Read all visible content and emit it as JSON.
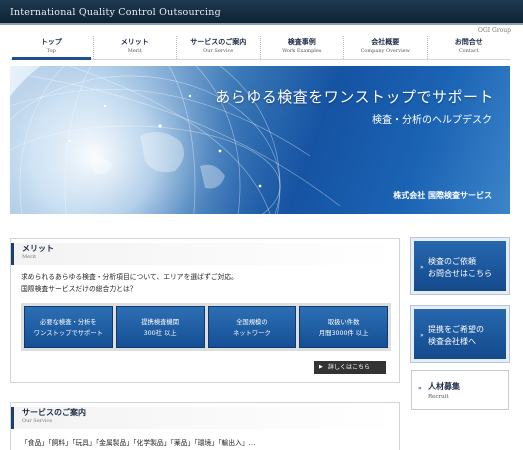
{
  "header": {
    "site_title": "International Quality Control Outsourcing",
    "group_label": "OGI Group"
  },
  "nav": [
    {
      "jp": "トップ",
      "en": "Top"
    },
    {
      "jp": "メリット",
      "en": "Merit"
    },
    {
      "jp": "サービスのご案内",
      "en": "Our Service"
    },
    {
      "jp": "検査事例",
      "en": "Work Examples"
    },
    {
      "jp": "会社概要",
      "en": "Company Overview"
    },
    {
      "jp": "お問合せ",
      "en": "Contact"
    }
  ],
  "hero": {
    "headline": "あらゆる検査をワンストップでサポート",
    "subheadline": "検査・分析のヘルプデスク",
    "company": "株式会社 国際検査サービス"
  },
  "merit": {
    "title": "メリット",
    "title_en": "Merit",
    "text_line1": "求められるあらゆる検査・分析項目について、エリアを選ばずご対応。",
    "text_line2": "国際検査サービスだけの総合力とは？",
    "features": [
      {
        "line1": "必要な検査・分析を",
        "line2": "ワンストップでサポート"
      },
      {
        "line1": "提携検査機関",
        "line2": "300社 以上"
      },
      {
        "line1": "全国規模の",
        "line2": "ネットワーク"
      },
      {
        "line1": "取扱い件数",
        "line2": "月間3000件 以上"
      }
    ],
    "detail_button": "詳しくはこちら"
  },
  "service": {
    "title": "サービスのご案内",
    "title_en": "Our Service",
    "list_text": "「食品」「飼料」「玩具」「金属製品」「化学製品」「薬品」「環境」「輸出入」…"
  },
  "sidebar": {
    "inquiry_line1": "検査のご依頼",
    "inquiry_line2": "お問合せはこちら",
    "partner_line1": "提携をご希望の",
    "partner_line2": "検査会社様へ",
    "recruit_jp": "人材募集",
    "recruit_en": "Recruit"
  },
  "colors": {
    "header_bg": "#0f2233",
    "accent_blue": "#1f4e8c",
    "button_blue": "#2767ad"
  }
}
